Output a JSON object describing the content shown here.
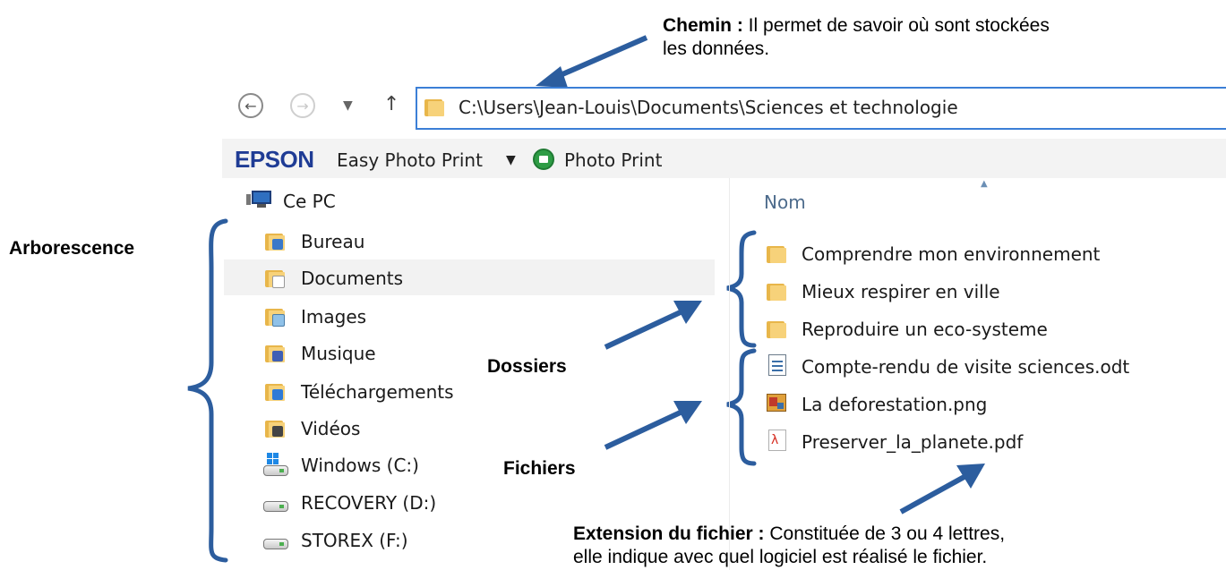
{
  "annotations": {
    "chemin_title": "Chemin :",
    "chemin_text_1": " Il permet de savoir où sont stockées",
    "chemin_text_2": "les données.",
    "arborescence": "Arborescence",
    "dossiers": "Dossiers",
    "fichiers": "Fichiers",
    "extension_title": "Extension du fichier :",
    "extension_text_1": " Constituée de 3 ou 4 lettres,",
    "extension_text_2": "elle indique avec quel logiciel est réalisé le fichier."
  },
  "nav": {
    "back_icon": "back-arrow-icon",
    "forward_icon": "forward-arrow-icon",
    "up_icon": "up-arrow-icon",
    "path": "C:\\Users\\Jean-Louis\\Documents\\Sciences et technologie"
  },
  "toolbar": {
    "brand": "EPSON",
    "easy_photo_print": "Easy Photo Print",
    "photo_print": "Photo Print"
  },
  "tree": {
    "root": "Ce PC",
    "items": [
      {
        "label": "Bureau",
        "icon": "desktop-folder-icon"
      },
      {
        "label": "Documents",
        "icon": "documents-folder-icon"
      },
      {
        "label": "Images",
        "icon": "images-folder-icon"
      },
      {
        "label": "Musique",
        "icon": "music-folder-icon"
      },
      {
        "label": "Téléchargements",
        "icon": "downloads-folder-icon"
      },
      {
        "label": "Vidéos",
        "icon": "videos-folder-icon"
      },
      {
        "label": "Windows (C:)",
        "icon": "windows-drive-icon"
      },
      {
        "label": "RECOVERY (D:)",
        "icon": "drive-icon"
      },
      {
        "label": "STOREX (F:)",
        "icon": "drive-icon"
      }
    ],
    "selected": "Documents"
  },
  "files": {
    "column_name": "Nom",
    "folders": [
      {
        "label": "Comprendre mon environnement"
      },
      {
        "label": "Mieux respirer en ville"
      },
      {
        "label": "Reproduire un eco-systeme"
      }
    ],
    "files": [
      {
        "label": "Compte-rendu de visite sciences.odt",
        "icon": "odt-file-icon"
      },
      {
        "label": "La deforestation.png",
        "icon": "png-file-icon"
      },
      {
        "label": "Preserver_la_planete.pdf",
        "icon": "pdf-file-icon"
      }
    ]
  },
  "colors": {
    "arrow": "#2c5d9e",
    "brand": "#1f3c95",
    "address_border": "#3c7fd6"
  }
}
